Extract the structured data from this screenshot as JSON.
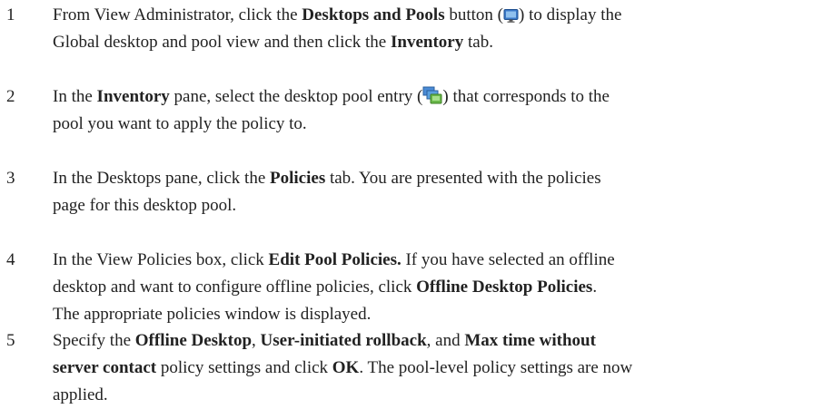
{
  "steps": [
    {
      "number": "1",
      "l1_a": "From View Administrator, click the ",
      "l1_b": "Desktops and Pools",
      "l1_c": " button (",
      "l1_icon": "monitor-icon",
      "l1_d": ") to display the",
      "l2_a": "Global desktop and pool view and then click the ",
      "l2_b": "Inventory",
      "l2_c": " tab."
    },
    {
      "number": "2",
      "l1_a": "In the ",
      "l1_b": "Inventory",
      "l1_c": " pane, select the desktop pool entry (",
      "l1_icon": "desktop-pool-icon",
      "l1_d": ") that corresponds to the",
      "l2_a": "pool you want to apply the policy to."
    },
    {
      "number": "3",
      "l1_a": "In the Desktops pane, click the ",
      "l1_b": "Policies",
      "l1_c": " tab. You are presented with the policies",
      "l2_a": "page for this desktop pool."
    },
    {
      "number": "4",
      "l1_a": "In the View Policies box, click ",
      "l1_b": "Edit Pool Policies.",
      "l1_c": " If you have selected an offline",
      "l2_a": "desktop and want to configure offline policies, click ",
      "l2_b": "Offline Desktop Policies",
      "l2_c": ".",
      "l3_a": "The appropriate policies window is displayed."
    },
    {
      "number": "5",
      "l1_a": "Specify the ",
      "l1_b": "Offline Desktop",
      "l1_c": ", ",
      "l1_d": "User-initiated rollback",
      "l1_e": ", and ",
      "l1_f": "Max time without",
      "l2_a": "server contact",
      "l2_b": " policy settings and click ",
      "l2_c": "OK",
      "l2_d": ". The pool-level policy settings are now",
      "l3_a": "applied."
    }
  ]
}
